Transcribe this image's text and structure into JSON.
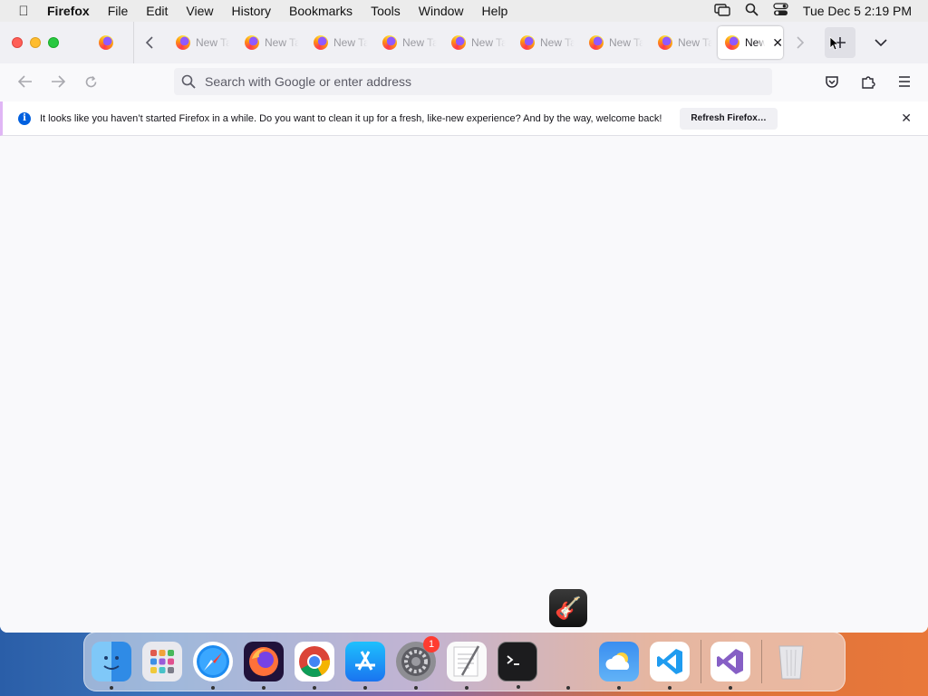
{
  "menubar": {
    "app_name": "Firefox",
    "items": [
      "File",
      "Edit",
      "View",
      "History",
      "Bookmarks",
      "Tools",
      "Window",
      "Help"
    ],
    "clock": "Tue Dec 5  2:19 PM"
  },
  "tabs": {
    "inactive_label": "New Tab",
    "inactive_count": 8,
    "active_label": "New Tab"
  },
  "urlbar": {
    "placeholder": "Search with Google or enter address"
  },
  "notification": {
    "message": "It looks like you haven’t started Firefox in a while. Do you want to clean it up for a fresh, like-new experience? And by the way, welcome back!",
    "button_label": "Refresh Firefox…"
  },
  "dock": {
    "settings_badge": "1",
    "apps": [
      "finder",
      "launchpad",
      "safari",
      "firefox",
      "chrome",
      "app-store",
      "system-settings",
      "textedit",
      "terminal",
      "weather",
      "vscode",
      "visual-studio",
      "trash"
    ]
  }
}
